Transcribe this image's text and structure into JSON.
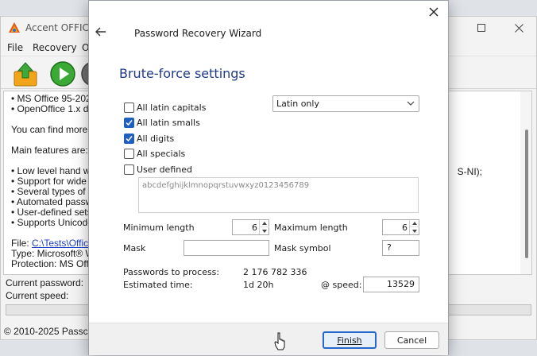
{
  "main_window": {
    "title": "Accent OFFICE",
    "menu": [
      "File",
      "Recovery",
      "O"
    ],
    "content_lines": [
      "• MS Office 95-2021",
      "• OpenOffice 1.x do",
      "You can find more inf",
      "Main features are:",
      "• Low level hand writ",
      "• Support for wide ra",
      "• Several types of at",
      "• Automated passwo",
      "• User-defined sets o",
      "• Supports Unicode a"
    ],
    "content_right_fragment": "S-NI);",
    "file_label": "File: ",
    "file_link": "C:\\Tests\\Office\\t",
    "type_line": "Type: Microsoft® Wo",
    "protection_line": "Protection: MS Office",
    "current_password_label": "Current password:",
    "current_speed_label": "Current speed:",
    "copyright": "© 2010-2025 Passcov"
  },
  "wizard": {
    "title": "Password Recovery Wizard",
    "heading": "Brute-force settings",
    "checkboxes": [
      {
        "label": "All latin capitals",
        "checked": false
      },
      {
        "label": "All latin smalls",
        "checked": true
      },
      {
        "label": "All digits",
        "checked": true
      },
      {
        "label": "All specials",
        "checked": false
      },
      {
        "label": "User defined",
        "checked": false
      }
    ],
    "charset_select": "Latin only",
    "user_defined_chars": "abcdefghijklmnopqrstuvwxyz0123456789",
    "min_length_label": "Minimum length",
    "min_length": "6",
    "max_length_label": "Maximum length",
    "max_length": "6",
    "mask_label": "Mask",
    "mask_value": "",
    "mask_symbol_label": "Mask symbol",
    "mask_symbol": "?",
    "passwords_label": "Passwords to process:",
    "passwords_value": "2 176 782 336",
    "estimated_label": "Estimated time:",
    "estimated_value": "1d 20h",
    "speed_label": "@ speed:",
    "speed_value": "13529",
    "finish_label": "Finish",
    "cancel_label": "Cancel"
  },
  "colors": {
    "accent": "#1f5fbf",
    "heading": "#1f3a8a",
    "link": "#1a3fc2"
  }
}
